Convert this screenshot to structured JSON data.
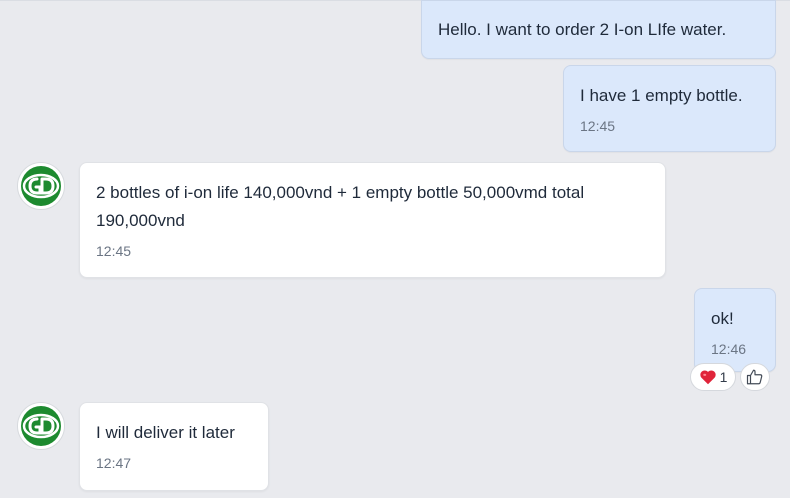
{
  "messages": [
    {
      "from": "me",
      "text": "Hello. I want to order 2 I-on LIfe water.",
      "time": ""
    },
    {
      "from": "me",
      "text": "I have 1 empty bottle.",
      "time": "12:45"
    },
    {
      "from": "them",
      "text": "2 bottles of i-on life 140,000vnd + 1 empty bottle 50,000vmd total 190,000vnd",
      "time": "12:45"
    },
    {
      "from": "me",
      "text": "ok!",
      "time": "12:46"
    },
    {
      "from": "them",
      "text": "I will deliver it later",
      "time": "12:47"
    }
  ],
  "reactions": {
    "heart_count": "1",
    "heart_icon": "heart-icon",
    "like_icon": "thumbs-up-icon"
  },
  "avatar": {
    "icon": "gd-logo-icon",
    "color": "#1d8a2f"
  },
  "colors": {
    "background": "#e9eaee",
    "outgoing_bubble": "#dbe8fb",
    "incoming_bubble": "#ffffff",
    "heart": "#e0243a"
  }
}
